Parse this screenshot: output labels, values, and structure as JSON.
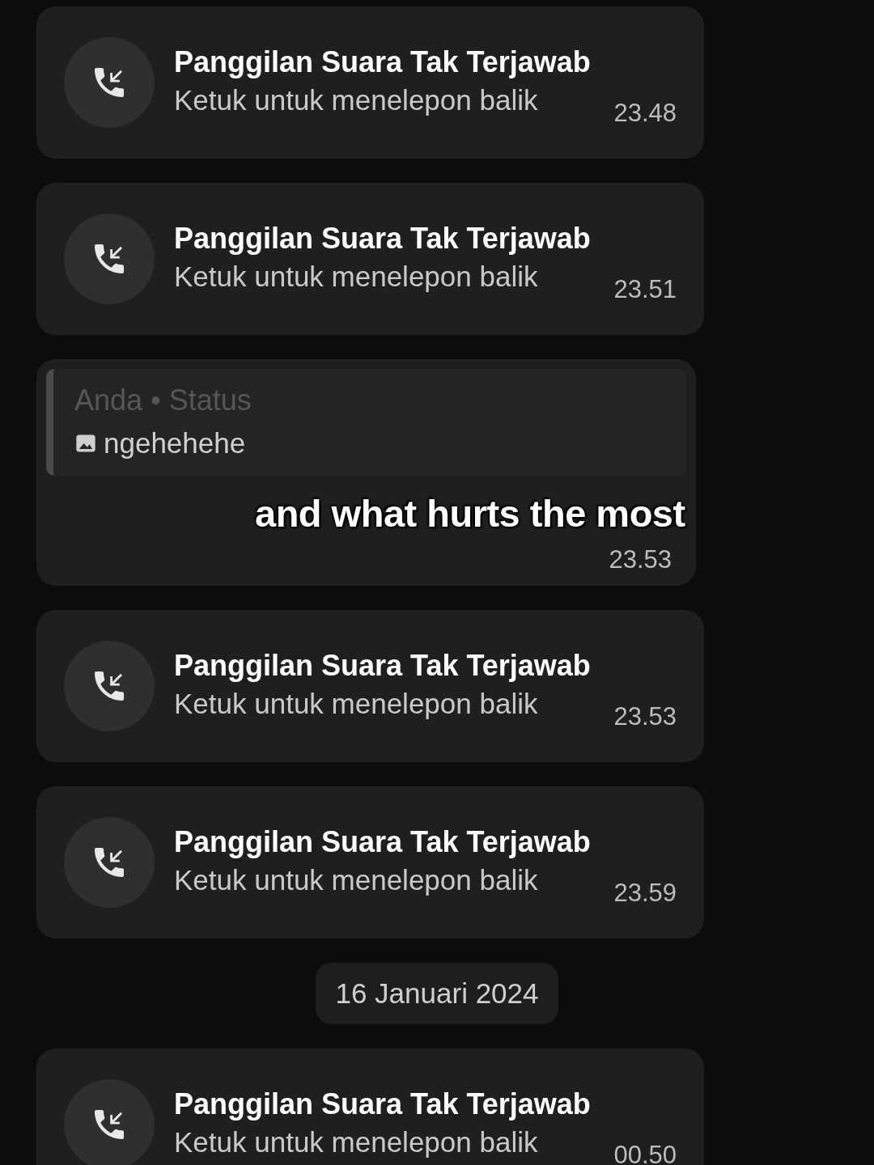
{
  "messages": [
    {
      "kind": "missed_call",
      "title": "Panggilan Suara Tak Terjawab",
      "subtitle": "Ketuk untuk menelepon balik",
      "time": "23.48"
    },
    {
      "kind": "missed_call",
      "title": "Panggilan Suara Tak Terjawab",
      "subtitle": "Ketuk untuk menelepon balik",
      "time": "23.51"
    },
    {
      "kind": "status_reply",
      "quote_author": "Anda • Status",
      "quote_text": "ngehehehe",
      "time": "23.53"
    },
    {
      "kind": "missed_call",
      "title": "Panggilan Suara Tak Terjawab",
      "subtitle": "Ketuk untuk menelepon balik",
      "time": "23.53"
    },
    {
      "kind": "missed_call",
      "title": "Panggilan Suara Tak Terjawab",
      "subtitle": "Ketuk untuk menelepon balik",
      "time": "23.59"
    },
    {
      "kind": "date",
      "label": "16 Januari 2024"
    },
    {
      "kind": "missed_call",
      "title": "Panggilan Suara Tak Terjawab",
      "subtitle": "Ketuk untuk menelepon balik",
      "time": "00.50"
    }
  ],
  "caption": "and what hurts the most"
}
